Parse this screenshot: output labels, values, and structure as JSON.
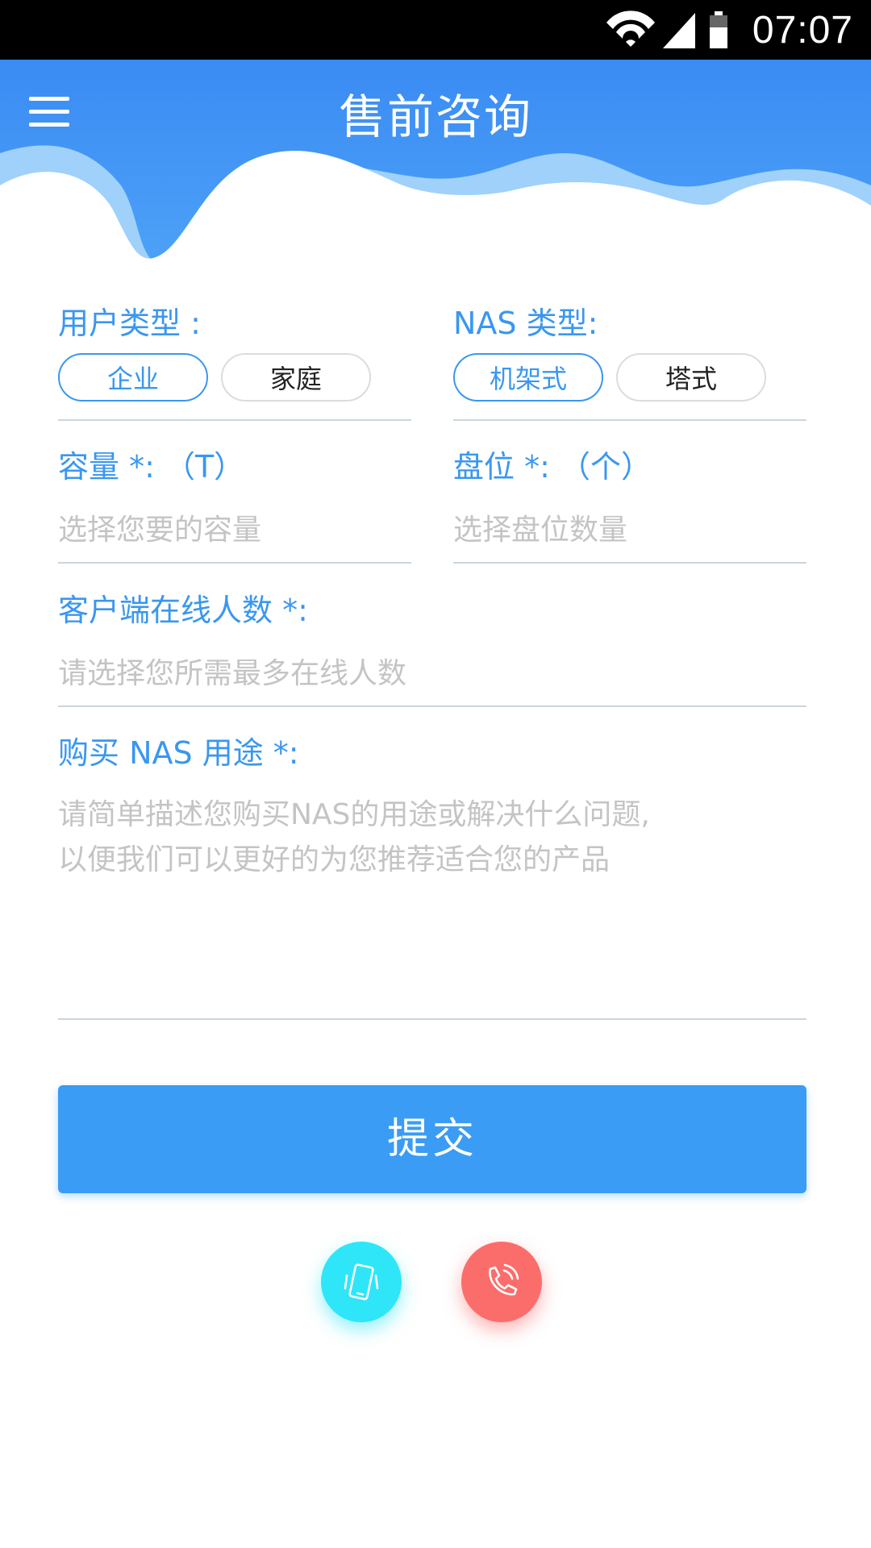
{
  "status_bar": {
    "time": "07:07",
    "icons": [
      "wifi-icon",
      "signal-icon",
      "battery-icon"
    ]
  },
  "header": {
    "title": "售前咨询",
    "menu_icon": "menu-icon",
    "color": "#3a8bf3"
  },
  "form": {
    "user_type": {
      "label": "用户类型 :",
      "options": [
        "企业",
        "家庭"
      ],
      "selected": "企业"
    },
    "nas_type": {
      "label": "NAS 类型:",
      "options": [
        "机架式",
        "塔式"
      ],
      "selected": "机架式"
    },
    "capacity": {
      "label": "容量 *: （T）",
      "placeholder": "选择您要的容量"
    },
    "bays": {
      "label": "盘位 *: （个）",
      "placeholder": "选择盘位数量"
    },
    "online_users": {
      "label": "客户端在线人数 *:",
      "placeholder": "请选择您所需最多在线人数"
    },
    "purpose": {
      "label": "购买 NAS 用途 *:",
      "placeholder_line1": "请简单描述您购买NAS的用途或解决什么问题,",
      "placeholder_line2": "以便我们可以更好的为您推荐适合您的产品"
    }
  },
  "submit_label": "提交",
  "fabs": [
    {
      "icon": "mobile-phone-icon",
      "color": "#2ee6f8"
    },
    {
      "icon": "phone-call-icon",
      "color": "#fb6d6b"
    }
  ],
  "colors": {
    "accent": "#3a97ef",
    "button": "#3a9cf4",
    "placeholder": "#c4c4c4"
  }
}
